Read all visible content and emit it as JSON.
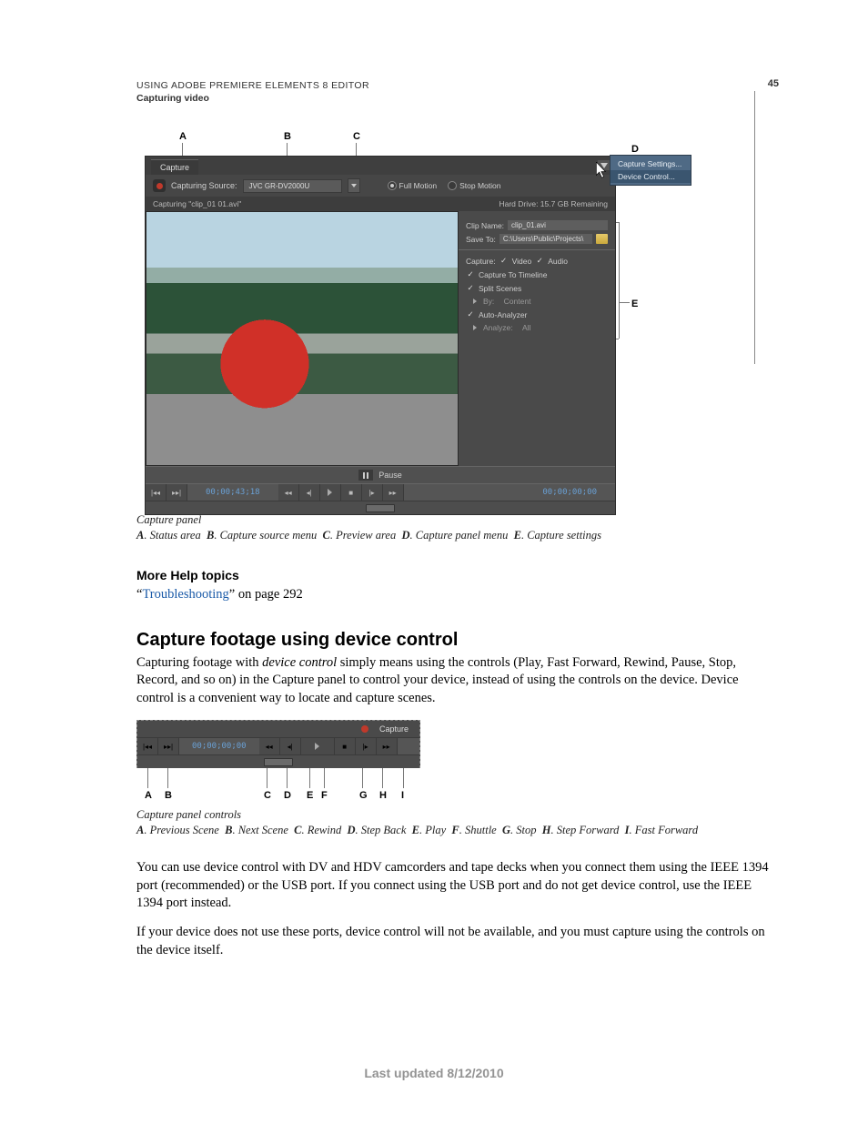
{
  "header": {
    "title": "USING ADOBE PREMIERE ELEMENTS 8 EDITOR",
    "section": "Capturing video",
    "page_number": "45"
  },
  "figure1": {
    "callouts": {
      "A": "A",
      "B": "B",
      "C": "C",
      "D": "D",
      "E": "E"
    },
    "panel": {
      "tab": "Capture",
      "source_label": "Capturing Source:",
      "source_value": "JVC GR-DV2000U",
      "mode_full": "Full Motion",
      "mode_stop": "Stop Motion",
      "status_left": "Capturing \"clip_01 01.avi\"",
      "status_right": "Hard Drive: 15.7 GB Remaining",
      "clip_name_label": "Clip Name:",
      "clip_name_value": "clip_01.avi",
      "save_to_label": "Save To:",
      "save_to_value": "C:\\Users\\Public\\Projects\\",
      "capture_label": "Capture:",
      "video_label": "Video",
      "audio_label": "Audio",
      "capture_to_timeline": "Capture To Timeline",
      "split_scenes": "Split Scenes",
      "by_label": "By:",
      "by_value": "Content",
      "auto_analyzer": "Auto-Analyzer",
      "analyze_label": "Analyze:",
      "analyze_value": "All",
      "pause_label": "Pause",
      "timecode_left": "00;00;43;18",
      "timecode_right": "00;00;00;00"
    },
    "flyout": {
      "item1": "Capture Settings...",
      "item2": "Device Control..."
    },
    "caption": "Capture panel",
    "key_parts": {
      "a_desc": "Status area",
      "b_desc": "Capture source menu",
      "c_desc": "Preview area",
      "d_desc": "Capture panel menu",
      "e_desc": "Capture settings"
    }
  },
  "more_help": {
    "heading": "More Help topics",
    "link_text": "Troubleshooting",
    "link_suffix": "” on page 292",
    "quote_open": "“"
  },
  "section2": {
    "heading": "Capture footage using device control",
    "para1_a": "Capturing footage with ",
    "para1_em": "device control",
    "para1_b": " simply means using the controls (Play, Fast Forward, Rewind, Pause, Stop, Record, and so on) in the Capture panel to control your device, instead of using the controls on the device. Device control is a convenient way to locate and capture scenes."
  },
  "figure2": {
    "capture_button": "Capture",
    "timecode": "00;00;00;00",
    "caption": "Capture panel controls",
    "callouts": {
      "A": "A",
      "B": "B",
      "C": "C",
      "D": "D",
      "E": "E",
      "F": "F",
      "G": "G",
      "H": "H",
      "I": "I"
    },
    "key_parts": {
      "a_desc": "Previous Scene",
      "b_desc": "Next Scene",
      "c_desc": "Rewind",
      "d_desc": "Step Back",
      "e_desc": "Play",
      "f_desc": "Shuttle",
      "g_desc": "Stop",
      "h_desc": "Step Forward",
      "i_desc": "Fast Forward"
    }
  },
  "para2": "You can use device control with DV and HDV camcorders and tape decks when you connect them using the IEEE 1394 port (recommended) or the USB port. If you connect using the USB port and do not get device control, use the IEEE 1394 port instead.",
  "para3": "If your device does not use these ports, device control will not be available, and you must capture using the controls on the device itself.",
  "footer": "Last updated 8/12/2010"
}
